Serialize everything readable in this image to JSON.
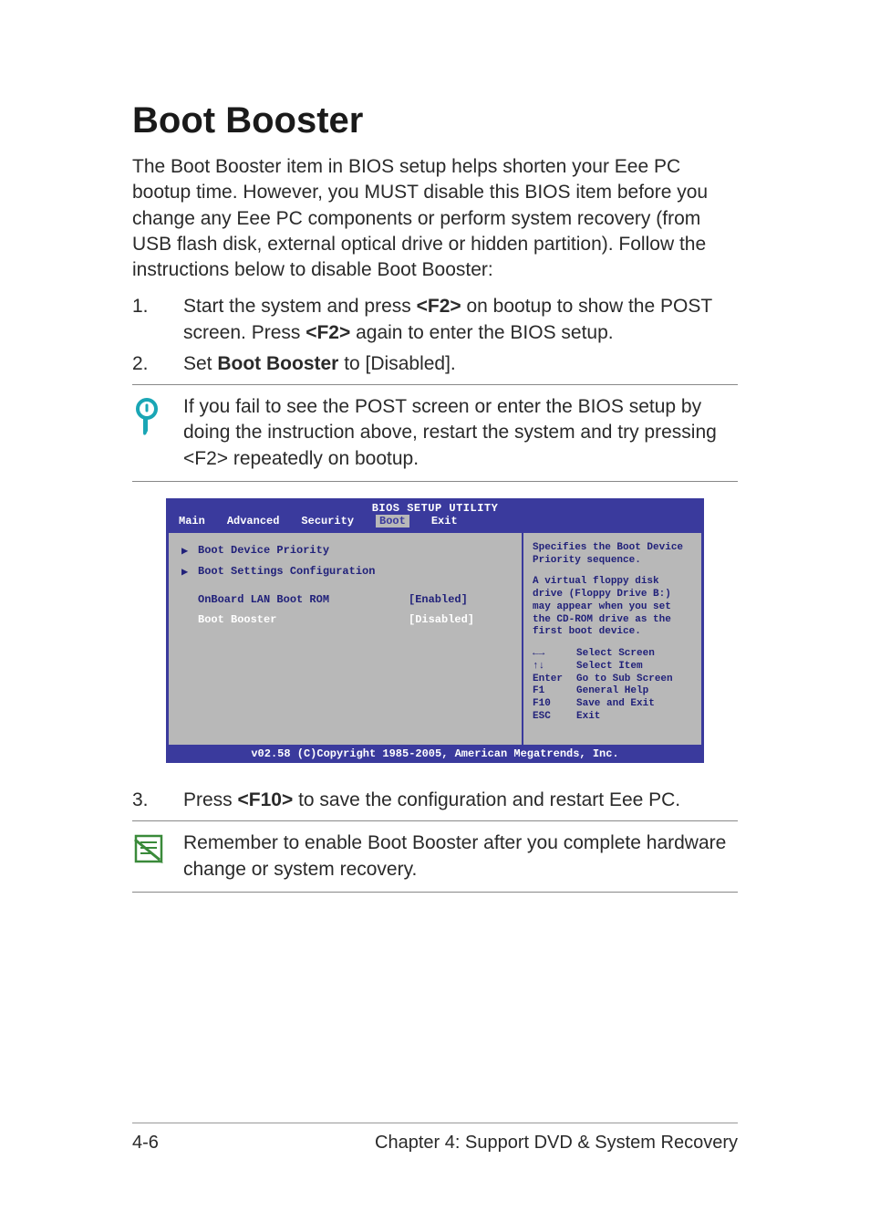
{
  "title": "Boot Booster",
  "intro": "The Boot Booster item in BIOS setup helps shorten your Eee PC bootup time. However, you MUST disable this BIOS item before you change any Eee PC components or perform system recovery (from USB flash disk, external optical drive or hidden partition). Follow the instructions below to disable Boot Booster:",
  "steps": {
    "s1num": "1.",
    "s1a": "Start the system and press ",
    "s1b": "<F2>",
    "s1c": " on bootup to show the POST screen. Press ",
    "s1d": "<F2>",
    "s1e": " again to enter the BIOS setup.",
    "s2num": "2.",
    "s2a": "Set ",
    "s2b": "Boot Booster",
    "s2c": " to [Disabled].",
    "s3num": "3.",
    "s3a": "Press ",
    "s3b": "<F10>",
    "s3c": " to save the configuration and restart Eee PC."
  },
  "note1": "If you fail to see the POST screen or enter the BIOS setup by doing the instruction above, restart the system and try pressing <F2> repeatedly on bootup.",
  "note2": "Remember to enable Boot Booster after you complete hardware change or system recovery.",
  "bios": {
    "title": "BIOS SETUP UTILITY",
    "tabs": {
      "main": "Main",
      "advanced": "Advanced",
      "security": "Security",
      "boot": "Boot",
      "exit": "Exit"
    },
    "rows": {
      "r1": "Boot Device Priority",
      "r2": "Boot Settings Configuration",
      "r3l": "OnBoard LAN Boot ROM",
      "r3v": "[Enabled]",
      "r4l": "Boot Booster",
      "r4v": "[Disabled]"
    },
    "help1": "Specifies the Boot Device Priority sequence.",
    "help2": "A virtual floppy disk drive (Floppy Drive B:) may appear when you set the CD-ROM drive as the first boot device.",
    "keys": {
      "k1": "←→",
      "v1": "Select Screen",
      "k2": "↑↓",
      "v2": "Select Item",
      "k3": "Enter",
      "v3": "Go to Sub Screen",
      "k4": "F1",
      "v4": "General Help",
      "k5": "F10",
      "v5": "Save and Exit",
      "k6": "ESC",
      "v6": "Exit"
    },
    "foot": "v02.58 (C)Copyright 1985-2005, American Megatrends, Inc."
  },
  "footer": {
    "left": "4-6",
    "right": "Chapter 4: Support DVD & System Recovery"
  }
}
